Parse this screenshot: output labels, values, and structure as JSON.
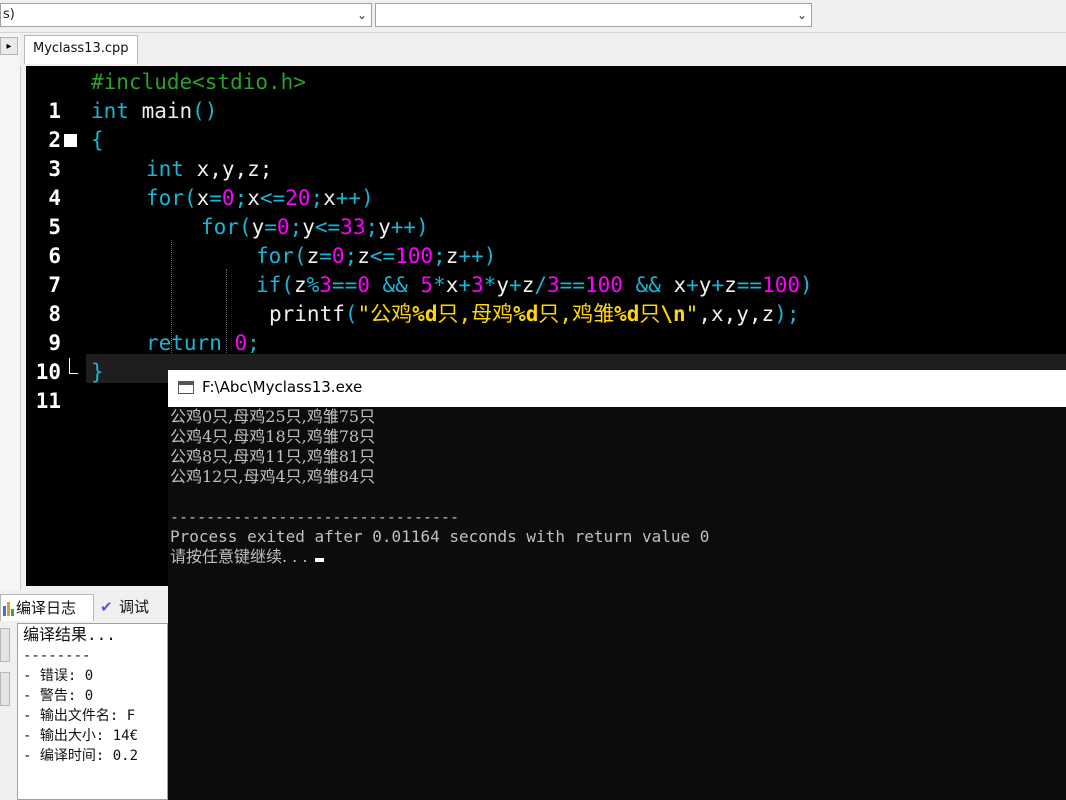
{
  "toolbar": {
    "combo1_value": "s)",
    "combo2_value": ""
  },
  "editor": {
    "tab_label": "Myclass13.cpp",
    "line_numbers": [
      "1",
      "2",
      "3",
      "4",
      "5",
      "6",
      "7",
      "8",
      "9",
      "10",
      "11"
    ],
    "lines": {
      "l1": "#include<stdio.h>",
      "l2_kw": "int",
      "l2_rest": " main",
      "l2_paren": "()",
      "l3": "{",
      "l4_kw": "int",
      "l4_rest": " x,y,z;",
      "l5": [
        "for",
        "(",
        "x",
        "=",
        "0",
        ";",
        "x",
        "<=",
        "20",
        ";",
        "x",
        "++",
        ")"
      ],
      "l6": [
        "for",
        "(",
        "y",
        "=",
        "0",
        ";",
        "y",
        "<=",
        "33",
        ";",
        "y",
        "++",
        ")"
      ],
      "l7": [
        "for",
        "(",
        "z",
        "=",
        "0",
        ";",
        "z",
        "<=",
        "100",
        ";",
        "z",
        "++",
        ")"
      ],
      "l8": [
        "if",
        "(",
        "z",
        "%",
        "3",
        "==",
        "0",
        " && ",
        "5",
        "*",
        "x",
        "+",
        "3",
        "*",
        "y",
        "+",
        "z",
        "/",
        "3",
        "==",
        "100",
        " && ",
        "x",
        "+",
        "y",
        "+",
        "z",
        "==",
        "100",
        ")"
      ],
      "l9": [
        "printf",
        "(",
        "\"公鸡",
        "%d",
        "只,母鸡",
        "%d",
        "只,鸡雏",
        "%d",
        "只",
        "\\n",
        "\"",
        ",x,y,z",
        ");"
      ],
      "l10_kw": "return",
      "l10_num": " 0",
      "l10_end": ";",
      "l11": "}"
    }
  },
  "console": {
    "title": "F:\\Abc\\Myclass13.exe",
    "output": [
      "公鸡0只,母鸡25只,鸡雏75只",
      "公鸡4只,母鸡18只,鸡雏78只",
      "公鸡8只,母鸡11只,鸡雏81只",
      "公鸡12只,母鸡4只,鸡雏84只",
      "",
      "--------------------------------",
      "Process exited after 0.01164 seconds with return value 0",
      "请按任意键继续. . . "
    ]
  },
  "bottom_panel": {
    "tab_compile_log": "编译日志",
    "tab_debug": "调试",
    "log_lines": [
      "编译结果...",
      "--------",
      "- 错误: 0",
      "- 警告: 0",
      "- 输出文件名: F",
      "- 输出大小: 14€",
      "- 编译时间: 0.2"
    ]
  },
  "colors": {
    "keyword": "#19b5d6",
    "preprocessor": "#2aa02a",
    "number": "#ff00ff",
    "string": "#ffd700",
    "console_bg": "#0c0c0c",
    "editor_bg": "#000000"
  }
}
